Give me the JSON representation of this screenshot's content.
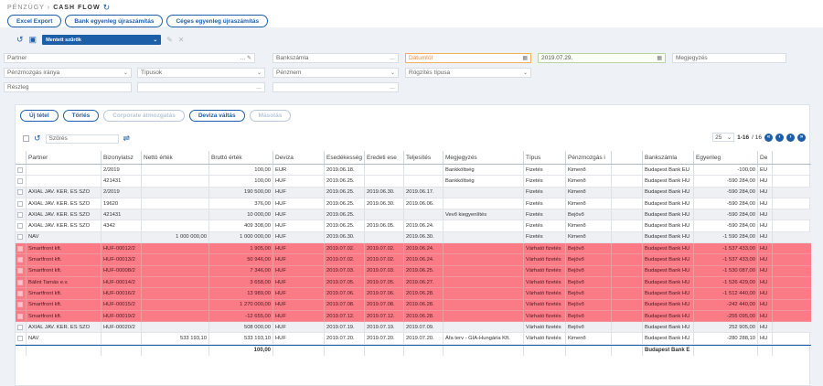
{
  "breadcrumb": {
    "section": "PÉNZÜGY",
    "separator": "›",
    "page": "CASH FLOW"
  },
  "top_buttons": [
    "Excel Export",
    "Bank egyenleg újraszámítás",
    "Céges egyenleg újraszámítás"
  ],
  "saved_filter": "Mentett szűrők",
  "filters": {
    "partner": "Partner",
    "bank_account": "Bankszámla",
    "date_from": "Dátumtól",
    "date_to": "2019.07.29.",
    "note": "Megjegyzés",
    "direction": "Pénzmozgás iránya",
    "types": "Típusok",
    "currency": "Pénznem",
    "record_type": "Rögzítés típusa",
    "detail": "Részleg"
  },
  "panel_buttons": {
    "new": "Új tétel",
    "delete": "Törlés",
    "corporate": "Corporate átmozgatás",
    "fx": "Deviza váltás",
    "copy": "Másolás"
  },
  "toolbar": {
    "search_placeholder": "Szűrés"
  },
  "pager": {
    "page_size": "25",
    "range": "1-16",
    "total": "/ 16"
  },
  "columns": [
    "Partner",
    "Bizonylatsz",
    "Nettó érték",
    "Bruttó érték",
    "Deviza",
    "Esedékesség",
    "Eredeti ese",
    "Teljesítés",
    "Megjegyzés",
    "Típus",
    "Pénzmozgás i",
    "",
    "Bankszámla",
    "Egyenleg",
    "De"
  ],
  "rows": [
    [
      "",
      "2/2019",
      "",
      "100,00",
      "EUR",
      "2019.06.18.",
      "",
      "",
      "Bankköltség",
      "Fizetés",
      "Kimenő",
      "",
      "Budapest Bank EU",
      "-100,00",
      "EU"
    ],
    [
      "",
      "421431",
      "",
      "100,00",
      "HUF",
      "2019.06.25.",
      "",
      "",
      "Bankköltség",
      "Fizetés",
      "Kimenő",
      "",
      "Budapest Bank HU",
      "-590 284,00",
      "HU"
    ],
    [
      "AXIAL JAV. KER. ES SZO",
      "2/2019",
      "",
      "190 500,00",
      "HUF",
      "2019.06.25.",
      "2019.06.30.",
      "2019.06.17.",
      "",
      "Fizetés",
      "Kimenő",
      "",
      "Budapest Bank HU",
      "-590 284,00",
      "HU"
    ],
    [
      "AXIAL JAV. KER. ES SZO",
      "19620",
      "",
      "376,00",
      "HUF",
      "2019.06.25.",
      "2019.06.30.",
      "2019.06.06.",
      "",
      "Fizetés",
      "Kimenő",
      "",
      "Budapest Bank HU",
      "-590 284,00",
      "HU"
    ],
    [
      "AXIAL JAV. KER. ES SZO",
      "421431",
      "",
      "10 000,00",
      "HUF",
      "2019.06.25.",
      "",
      "",
      "Vevő kiegyenlítés",
      "Fizetés",
      "Bejövő",
      "",
      "Budapest Bank HU",
      "-590 284,00",
      "HU"
    ],
    [
      "AXIAL JAV. KER. ES SZO",
      "4342",
      "",
      "409 308,00",
      "HUF",
      "2019.06.25.",
      "2019.06.05.",
      "2019.06.24.",
      "",
      "Fizetés",
      "Kimenő",
      "",
      "Budapest Bank HU",
      "-590 284,00",
      "HU"
    ],
    [
      "NAV",
      "",
      "1 000 000,00",
      "1 000 000,00",
      "HUF",
      "2019.06.30.",
      "",
      "2019.06.30.",
      "",
      "Fizetés",
      "Kimenő",
      "",
      "Budapest Bank HU",
      "-1 590 284,00",
      "HU"
    ],
    [
      "Smartfront kft.",
      "HUF-00012/2",
      "",
      "1 905,00",
      "HUF",
      "2019.07.02.",
      "2019.07.02.",
      "2019.06.24.",
      "",
      "Várható fizetés",
      "Bejövő",
      "",
      "Budapest Bank HU",
      "-1 537 433,00",
      "HU"
    ],
    [
      "Smartfront kft.",
      "HUF-00013/2",
      "",
      "50 946,00",
      "HUF",
      "2019.07.02.",
      "2019.07.02.",
      "2019.06.24.",
      "",
      "Várható fizetés",
      "Bejövő",
      "",
      "Budapest Bank HU",
      "-1 537 433,00",
      "HU"
    ],
    [
      "Smartfront kft.",
      "HUF-00008/2",
      "",
      "7 346,00",
      "HUF",
      "2019.07.03.",
      "2019.07.03.",
      "2019.06.25.",
      "",
      "Várható fizetés",
      "Bejövő",
      "",
      "Budapest Bank HU",
      "-1 530 087,00",
      "HU"
    ],
    [
      "Bálint Tamás e.v.",
      "HUF-00014/2",
      "",
      "3 658,00",
      "HUF",
      "2019.07.05.",
      "2019.07.05.",
      "2019.06.27.",
      "",
      "Várható fizetés",
      "Bejövő",
      "",
      "Budapest Bank HU",
      "-1 526 429,00",
      "HU"
    ],
    [
      "Smartfront kft.",
      "HUF-00016/2",
      "",
      "13 989,00",
      "HUF",
      "2019.07.06.",
      "2019.07.06.",
      "2019.06.28.",
      "",
      "Várható fizetés",
      "Bejövő",
      "",
      "Budapest Bank HU",
      "-1 512 440,00",
      "HU"
    ],
    [
      "Smartfront kft.",
      "HUF-00015/2",
      "",
      "1 270 000,00",
      "HUF",
      "2019.07.08.",
      "2019.07.08.",
      "2019.06.28.",
      "",
      "Várható fizetés",
      "Bejövő",
      "",
      "Budapest Bank HU",
      "-242 440,00",
      "HU"
    ],
    [
      "Smartfront kft.",
      "HUF-00019/2",
      "",
      "-12 655,00",
      "HUF",
      "2019.07.12.",
      "2019.07.12.",
      "2019.06.28.",
      "",
      "Várható fizetés",
      "Bejövő",
      "",
      "Budapest Bank HU",
      "-255 095,00",
      "HU"
    ],
    [
      "AXIAL JAV. KER. ES SZO",
      "HUF-00020/2",
      "",
      "508 000,00",
      "HUF",
      "2019.07.19.",
      "2019.07.19.",
      "2019.07.09.",
      "",
      "Várható fizetés",
      "Bejövő",
      "",
      "Budapest Bank HU",
      "252 905,00",
      "HU"
    ],
    [
      "NAV",
      "",
      "533 193,10",
      "533 193,10",
      "HUF",
      "2019.07.20.",
      "2019.07.20.",
      "2019.07.20.",
      "Áfa terv - GIA-Hungária Kft.",
      "Várható fizetés",
      "Kimenő",
      "",
      "Budapest Bank HU",
      "-280 288,10",
      "HU"
    ]
  ],
  "row_styles": [
    "plain",
    "plain",
    "alt",
    "plain",
    "alt",
    "plain",
    "alt",
    "red",
    "red",
    "red",
    "red",
    "red",
    "red",
    "red",
    "alt",
    "plain"
  ],
  "footer": {
    "gross_total": "100,00",
    "bank": "Budapest Bank E"
  },
  "colors": {
    "accent": "#1c5fa8",
    "highlight": "#fa7a86"
  }
}
